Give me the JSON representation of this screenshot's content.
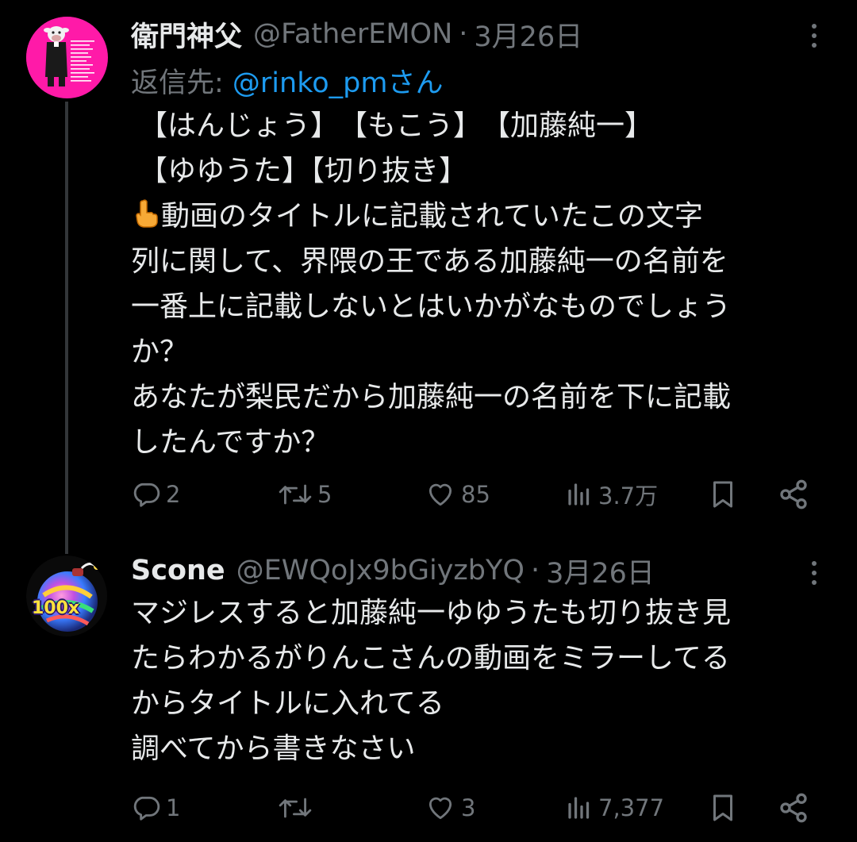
{
  "tweets": [
    {
      "author_name": "衛門神父",
      "handle": "@FatherEMON",
      "separator": "·",
      "date": "3月26日",
      "reply_prefix": "返信先: ",
      "reply_to": "@rinko_pmさん",
      "lines": [
        "【はんじょう】　【もこう】　【加藤純一】",
        "【ゆゆうた】【切り抜き】",
        "動画のタイトルに記載されていたこの文字",
        "列に関して、界隈の王である加藤純一の名前を",
        "一番上に記載しないとはいかがなものでしょう",
        "か？",
        "あなたが梨民だから加藤純一の名前を下に記載",
        "したんですか？"
      ],
      "emoji_icon": "backhand-index-pointing-up-icon",
      "stats": {
        "replies": "2",
        "retweets": "5",
        "likes": "85",
        "views": "3.7万"
      }
    },
    {
      "author_name": "Scone",
      "handle": "@EWQoJx9bGiyzbYQ",
      "separator": "·",
      "date": "3月26日",
      "lines": [
        "マジレスすると加藤純一ゆゆうたも切り抜き見",
        "たらわかるがりんこさんの動画をミラーしてる",
        "からタイトルに入れてる",
        "調べてから書きなさい"
      ],
      "avatar_badge": "100x",
      "stats": {
        "replies": "1",
        "retweets": "",
        "likes": "3",
        "views": "7,377"
      }
    }
  ],
  "colors": {
    "background": "#000000",
    "text": "#e7e9ea",
    "muted": "#71767b",
    "link": "#1d9bf0",
    "avatar1_bg": "#ff1aa8"
  }
}
